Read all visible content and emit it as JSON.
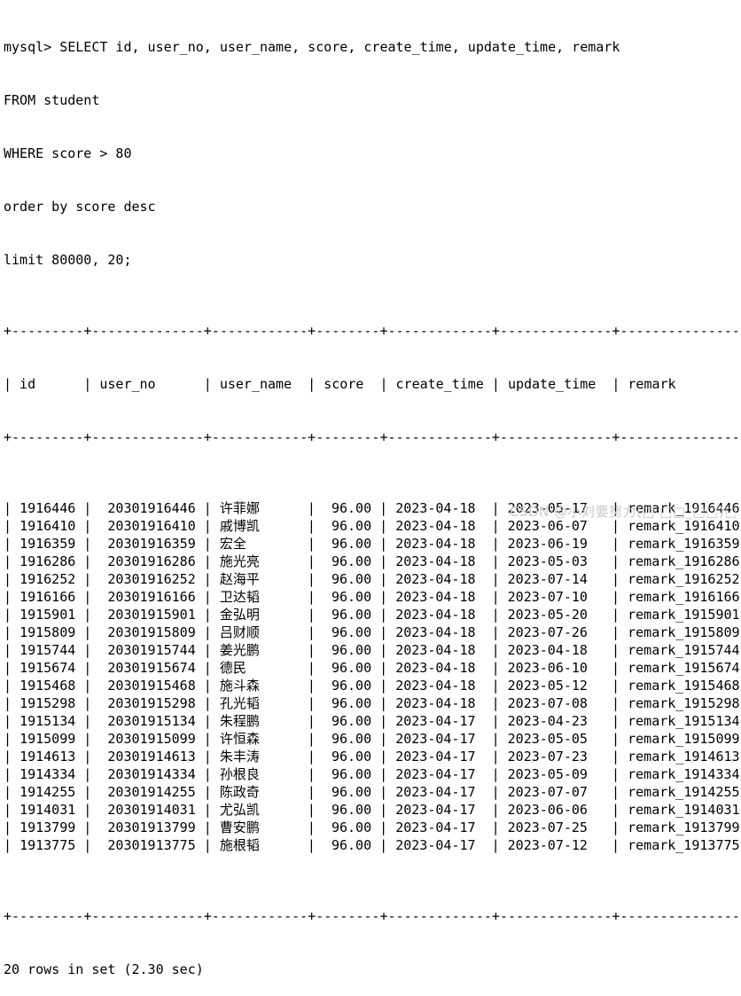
{
  "terminal": {
    "prompt": "mysql> ",
    "query_lines": [
      "mysql> SELECT id, user_no, user_name, score, create_time, update_time, remark",
      "FROM student",
      "WHERE score > 80",
      "order by score desc",
      "limit 80000, 20;"
    ],
    "separator": "+---------+--------------+------------+--------+-------------+--------------+-----------------+",
    "header_row": "| id      | user_no      | user_name  | score  | create_time | update_time  | remark          |",
    "columns": [
      "id",
      "user_no",
      "user_name",
      "score",
      "create_time",
      "update_time",
      "remark"
    ],
    "rows": [
      {
        "id": "1916446",
        "user_no": "20301916446",
        "user_name": "许菲娜",
        "score": "96.00",
        "create_time": "2023-04-18",
        "update_time": "2023-05-17",
        "remark": "remark_1916446"
      },
      {
        "id": "1916410",
        "user_no": "20301916410",
        "user_name": "戚博凯",
        "score": "96.00",
        "create_time": "2023-04-18",
        "update_time": "2023-06-07",
        "remark": "remark_1916410"
      },
      {
        "id": "1916359",
        "user_no": "20301916359",
        "user_name": "宏全",
        "score": "96.00",
        "create_time": "2023-04-18",
        "update_time": "2023-06-19",
        "remark": "remark_1916359"
      },
      {
        "id": "1916286",
        "user_no": "20301916286",
        "user_name": "施光亮",
        "score": "96.00",
        "create_time": "2023-04-18",
        "update_time": "2023-05-03",
        "remark": "remark_1916286"
      },
      {
        "id": "1916252",
        "user_no": "20301916252",
        "user_name": "赵海平",
        "score": "96.00",
        "create_time": "2023-04-18",
        "update_time": "2023-07-14",
        "remark": "remark_1916252"
      },
      {
        "id": "1916166",
        "user_no": "20301916166",
        "user_name": "卫达韬",
        "score": "96.00",
        "create_time": "2023-04-18",
        "update_time": "2023-07-10",
        "remark": "remark_1916166"
      },
      {
        "id": "1915901",
        "user_no": "20301915901",
        "user_name": "金弘明",
        "score": "96.00",
        "create_time": "2023-04-18",
        "update_time": "2023-05-20",
        "remark": "remark_1915901"
      },
      {
        "id": "1915809",
        "user_no": "20301915809",
        "user_name": "吕财顺",
        "score": "96.00",
        "create_time": "2023-04-18",
        "update_time": "2023-07-26",
        "remark": "remark_1915809"
      },
      {
        "id": "1915744",
        "user_no": "20301915744",
        "user_name": "姜光鹏",
        "score": "96.00",
        "create_time": "2023-04-18",
        "update_time": "2023-04-18",
        "remark": "remark_1915744"
      },
      {
        "id": "1915674",
        "user_no": "20301915674",
        "user_name": "德民",
        "score": "96.00",
        "create_time": "2023-04-18",
        "update_time": "2023-06-10",
        "remark": "remark_1915674"
      },
      {
        "id": "1915468",
        "user_no": "20301915468",
        "user_name": "施斗森",
        "score": "96.00",
        "create_time": "2023-04-18",
        "update_time": "2023-05-12",
        "remark": "remark_1915468"
      },
      {
        "id": "1915298",
        "user_no": "20301915298",
        "user_name": "孔光韬",
        "score": "96.00",
        "create_time": "2023-04-18",
        "update_time": "2023-07-08",
        "remark": "remark_1915298"
      },
      {
        "id": "1915134",
        "user_no": "20301915134",
        "user_name": "朱程鹏",
        "score": "96.00",
        "create_time": "2023-04-17",
        "update_time": "2023-04-23",
        "remark": "remark_1915134"
      },
      {
        "id": "1915099",
        "user_no": "20301915099",
        "user_name": "许恒森",
        "score": "96.00",
        "create_time": "2023-04-17",
        "update_time": "2023-05-05",
        "remark": "remark_1915099"
      },
      {
        "id": "1914613",
        "user_no": "20301914613",
        "user_name": "朱丰涛",
        "score": "96.00",
        "create_time": "2023-04-17",
        "update_time": "2023-07-23",
        "remark": "remark_1914613"
      },
      {
        "id": "1914334",
        "user_no": "20301914334",
        "user_name": "孙根良",
        "score": "96.00",
        "create_time": "2023-04-17",
        "update_time": "2023-05-09",
        "remark": "remark_1914334"
      },
      {
        "id": "1914255",
        "user_no": "20301914255",
        "user_name": "陈政奇",
        "score": "96.00",
        "create_time": "2023-04-17",
        "update_time": "2023-07-07",
        "remark": "remark_1914255"
      },
      {
        "id": "1914031",
        "user_no": "20301914031",
        "user_name": "尤弘凯",
        "score": "96.00",
        "create_time": "2023-04-17",
        "update_time": "2023-06-06",
        "remark": "remark_1914031"
      },
      {
        "id": "1913799",
        "user_no": "20301913799",
        "user_name": "曹安鹏",
        "score": "96.00",
        "create_time": "2023-04-17",
        "update_time": "2023-07-25",
        "remark": "remark_1913799"
      },
      {
        "id": "1913775",
        "user_no": "20301913775",
        "user_name": "施根韬",
        "score": "96.00",
        "create_time": "2023-04-17",
        "update_time": "2023-07-12",
        "remark": "remark_1913775"
      }
    ],
    "result_summary": "20 rows in set (2.30 sec)",
    "row_count": 20,
    "elapsed_seconds": "2.30"
  },
  "watermark": {
    "text": "CSDN @小刘要努力(□ □□_□□)□",
    "color": "#c9c9c9"
  },
  "theme": {
    "background": "#ffffff",
    "foreground": "#000000"
  }
}
